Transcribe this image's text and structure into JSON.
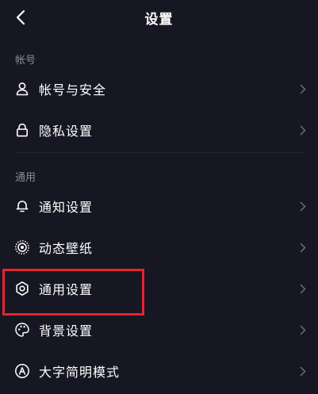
{
  "header": {
    "title": "设置"
  },
  "sections": {
    "account": {
      "label": "帐号",
      "items": [
        {
          "label": "帐号与安全"
        },
        {
          "label": "隐私设置"
        }
      ]
    },
    "general": {
      "label": "通用",
      "items": [
        {
          "label": "通知设置"
        },
        {
          "label": "动态壁纸"
        },
        {
          "label": "通用设置"
        },
        {
          "label": "背景设置"
        },
        {
          "label": "大字简明模式"
        }
      ]
    }
  },
  "highlight_color": "#e8232f",
  "icons": {
    "back": "chevron-left-icon",
    "account_security": "user-icon",
    "privacy": "lock-icon",
    "notification": "bell-icon",
    "live_wallpaper": "live-wallpaper-icon",
    "general_settings": "gear-icon",
    "background": "palette-icon",
    "large_text": "text-size-icon",
    "row_arrow": "chevron-right-icon"
  }
}
